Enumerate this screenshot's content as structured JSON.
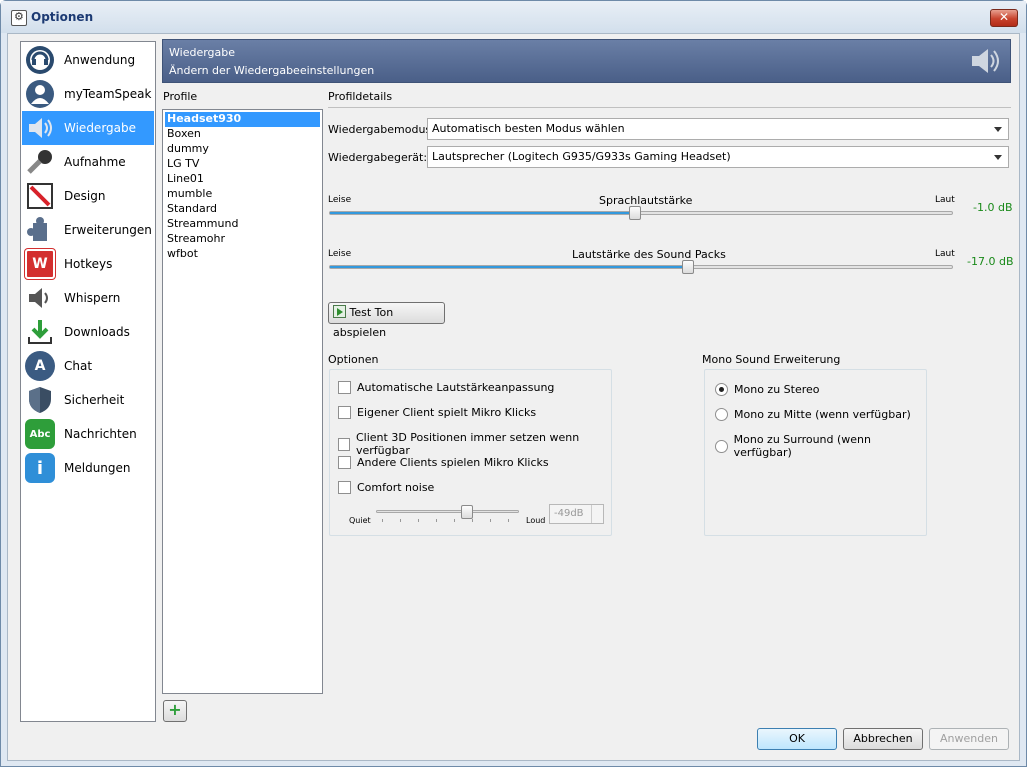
{
  "window": {
    "title": "Optionen",
    "close_glyph": "✕"
  },
  "sidebar": {
    "items": [
      {
        "label": "Anwendung",
        "icon": "headset-icon",
        "selected": false
      },
      {
        "label": "myTeamSpeak",
        "icon": "user-icon",
        "selected": false
      },
      {
        "label": "Wiedergabe",
        "icon": "speaker-icon",
        "selected": true
      },
      {
        "label": "Aufnahme",
        "icon": "microphone-icon",
        "selected": false
      },
      {
        "label": "Design",
        "icon": "design-icon",
        "selected": false
      },
      {
        "label": "Erweiterungen",
        "icon": "puzzle-icon",
        "selected": false
      },
      {
        "label": "Hotkeys",
        "icon": "hotkey-icon",
        "selected": false
      },
      {
        "label": "Whispern",
        "icon": "whisper-icon",
        "selected": false
      },
      {
        "label": "Downloads",
        "icon": "download-icon",
        "selected": false
      },
      {
        "label": "Chat",
        "icon": "chat-icon",
        "selected": false
      },
      {
        "label": "Sicherheit",
        "icon": "shield-icon",
        "selected": false
      },
      {
        "label": "Nachrichten",
        "icon": "messages-icon",
        "selected": false
      },
      {
        "label": "Meldungen",
        "icon": "info-icon",
        "selected": false
      }
    ],
    "icon_glyphs": {
      "hotkeys": "W",
      "chat": "A",
      "messages": "Abc",
      "info": "i"
    }
  },
  "header": {
    "title": "Wiedergabe",
    "subtitle": "Ändern der Wiedergabeeinstellungen"
  },
  "profiles": {
    "label": "Profile",
    "items": [
      "Headset930",
      "Boxen",
      "dummy",
      "LG TV",
      "Line01",
      "mumble",
      "Standard",
      "Streammund",
      "Streamohr",
      "wfbot"
    ],
    "selected_index": 0,
    "add_glyph": "+"
  },
  "details": {
    "label": "Profildetails",
    "mode_label": "Wiedergabemodus:",
    "mode_value": "Automatisch besten Modus wählen",
    "device_label": "Wiedergabegerät:",
    "device_value": "Lautsprecher (Logitech G935/G933s Gaming Headset)"
  },
  "sliders": {
    "voice": {
      "title": "Sprachlautstärke",
      "min_label": "Leise",
      "max_label": "Laut",
      "value_label": "-1.0 dB",
      "fraction": 0.49
    },
    "soundpack": {
      "title": "Lautstärke des Sound Packs",
      "min_label": "Leise",
      "max_label": "Laut",
      "value_label": "-17.0 dB",
      "fraction": 0.575
    }
  },
  "test_button": {
    "label": "Test Ton abspielen"
  },
  "options": {
    "title": "Optionen",
    "items": [
      "Automatische Lautstärkeanpassung",
      "Eigener Client spielt Mikro Klicks",
      "Client 3D Positionen immer setzen wenn verfügbar",
      "Andere Clients spielen Mikro Klicks",
      "Comfort noise"
    ],
    "noise_slider": {
      "min_label": "Quiet",
      "max_label": "Loud",
      "value": "-49dB",
      "fraction": 0.64
    }
  },
  "mono": {
    "title": "Mono Sound Erweiterung",
    "items": [
      "Mono zu Stereo",
      "Mono zu Mitte (wenn verfügbar)",
      "Mono zu Surround (wenn verfügbar)"
    ],
    "selected_index": 0
  },
  "footer": {
    "ok": "OK",
    "cancel": "Abbrechen",
    "apply": "Anwenden"
  },
  "colors": {
    "selection": "#3399ff",
    "header": "#55698f",
    "db_value": "#1a8a1a"
  }
}
